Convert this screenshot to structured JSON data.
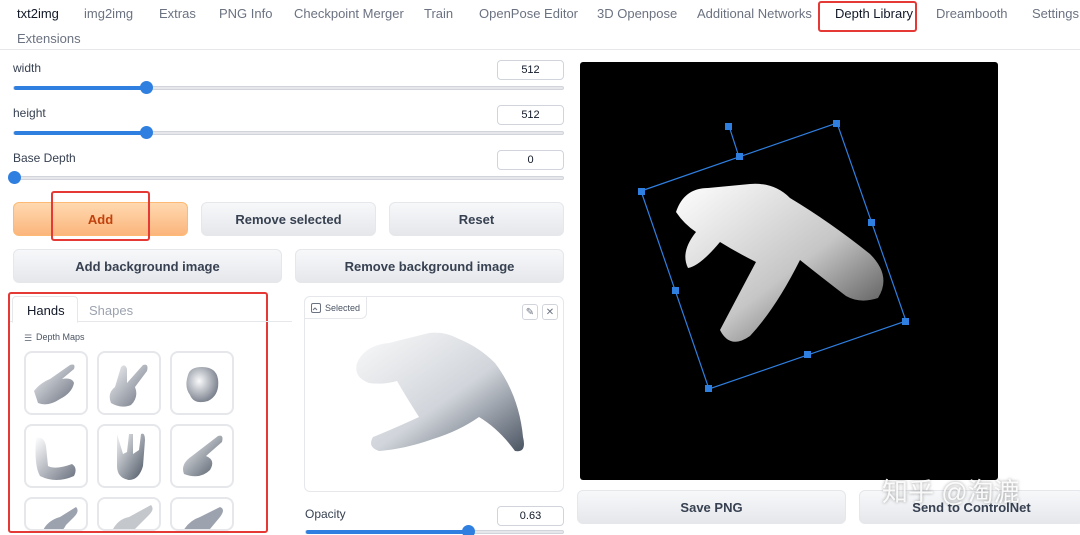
{
  "tabs": [
    {
      "label": "txt2img"
    },
    {
      "label": "img2img"
    },
    {
      "label": "Extras"
    },
    {
      "label": "PNG Info"
    },
    {
      "label": "Checkpoint Merger"
    },
    {
      "label": "Train"
    },
    {
      "label": "OpenPose Editor"
    },
    {
      "label": "3D Openpose"
    },
    {
      "label": "Additional Networks"
    },
    {
      "label": "Depth Library"
    },
    {
      "label": "Dreambooth"
    },
    {
      "label": "Settings"
    },
    {
      "label": "Extensions"
    }
  ],
  "active_tab": "Depth Library",
  "sliders": {
    "width": {
      "label": "width",
      "value": "512",
      "fraction": 0.24
    },
    "height": {
      "label": "height",
      "value": "512",
      "fraction": 0.24
    },
    "base_depth": {
      "label": "Base Depth",
      "value": "0",
      "fraction": 0.0
    }
  },
  "buttons": {
    "add": "Add",
    "remove_selected": "Remove selected",
    "reset": "Reset",
    "add_background": "Add background image",
    "remove_background": "Remove background image",
    "save_png": "Save PNG",
    "send_to_controlnet": "Send to ControlNet"
  },
  "library": {
    "tabs": [
      "Hands",
      "Shapes"
    ],
    "active_tab": "Hands",
    "section_label": "Depth Maps"
  },
  "selected_panel": {
    "label": "Selected"
  },
  "opacity": {
    "label": "Opacity",
    "value": "0.63",
    "fraction": 0.63
  },
  "watermark": "知乎 @淘漉",
  "colors": {
    "accent": "#2f7fe0",
    "primary_button": "#fbb57c",
    "highlight": "#e53935"
  }
}
